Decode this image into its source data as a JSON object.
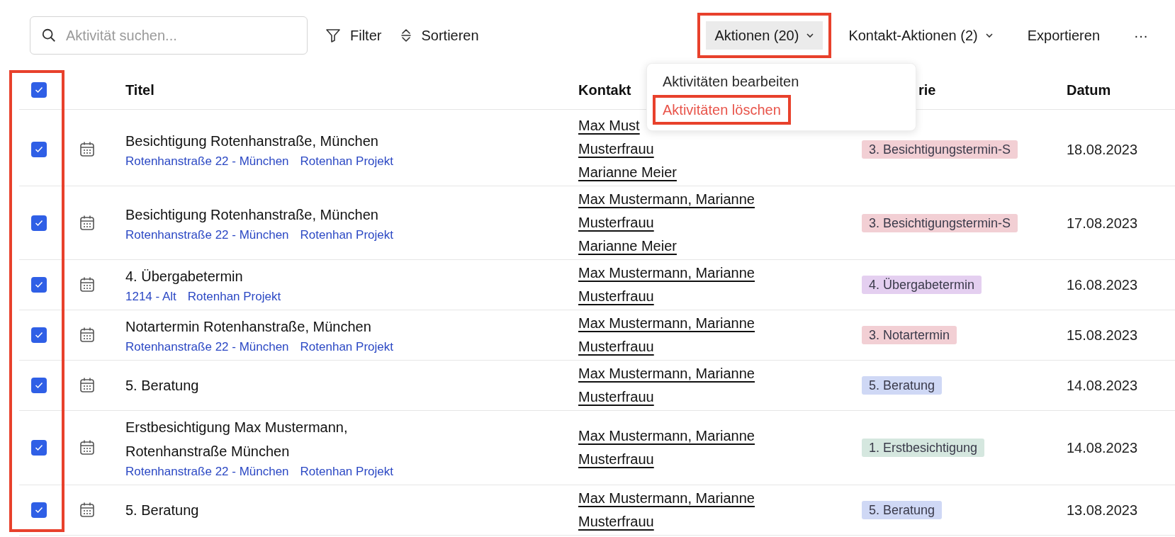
{
  "toolbar": {
    "search": {
      "placeholder": "Aktivität suchen..."
    },
    "tools": [
      {
        "kind": "filter",
        "label": "Filter"
      },
      {
        "kind": "sort",
        "label": "Sortieren"
      }
    ],
    "actions": [
      {
        "kind": "dropdown",
        "label": "Aktionen (20)",
        "open": true,
        "highlighted": true
      },
      {
        "kind": "dropdown",
        "label": "Kontakt-Aktionen (2)",
        "open": false,
        "highlighted": false
      },
      {
        "kind": "plain",
        "label": "Exportieren",
        "open": false,
        "highlighted": false
      },
      {
        "kind": "plain",
        "label": "···",
        "open": false,
        "highlighted": false
      }
    ]
  },
  "menu": {
    "items": [
      {
        "label": "Aktivitäten bearbeiten",
        "danger": false,
        "highlighted": false
      },
      {
        "label": "Aktivitäten löschen",
        "danger": true,
        "highlighted": true
      }
    ]
  },
  "table": {
    "select_all": {
      "checked": true
    },
    "checkbox_column_highlighted": true,
    "columns": [
      "Titel",
      "Kontakt",
      "rie",
      "Datum"
    ],
    "rows": [
      {
        "checked": true,
        "title": "Besichtigung Rotenhanstraße, München",
        "links": [
          "Rotenhanstraße 22 - München",
          "Rotenhan Projekt"
        ],
        "contacts": [
          "Max Must",
          "Musterfrauu",
          "Marianne Meier"
        ],
        "category": {
          "label": "3. Besichtigungstermin-S",
          "color": "#f2cfd4"
        },
        "date": "18.08.2023"
      },
      {
        "checked": true,
        "title": "Besichtigung Rotenhanstraße, München",
        "links": [
          "Rotenhanstraße 22 - München",
          "Rotenhan Projekt"
        ],
        "contacts": [
          "Max Mustermann, Marianne",
          "Musterfrauu",
          "Marianne Meier"
        ],
        "category": {
          "label": "3. Besichtigungstermin-S",
          "color": "#f2cfd4"
        },
        "date": "17.08.2023"
      },
      {
        "checked": true,
        "title": "4. Übergabetermin",
        "links": [
          "1214 - Alt",
          "Rotenhan Projekt"
        ],
        "contacts": [
          "Max Mustermann, Marianne",
          "Musterfrauu"
        ],
        "category": {
          "label": "4. Übergabetermin",
          "color": "#e4cff0"
        },
        "date": "16.08.2023"
      },
      {
        "checked": true,
        "title": "Notartermin Rotenhanstraße, München",
        "links": [
          "Rotenhanstraße 22 - München",
          "Rotenhan Projekt"
        ],
        "contacts": [
          "Max Mustermann, Marianne",
          "Musterfrauu"
        ],
        "category": {
          "label": "3. Notartermin",
          "color": "#f2cfd4"
        },
        "date": "15.08.2023"
      },
      {
        "checked": true,
        "title": "5. Beratung",
        "links": [],
        "contacts": [
          "Max Mustermann, Marianne",
          "Musterfrauu"
        ],
        "category": {
          "label": "5. Beratung",
          "color": "#cfd8f5"
        },
        "date": "14.08.2023"
      },
      {
        "checked": true,
        "title": "Erstbesichtigung Max Mustermann, Rotenhanstraße München",
        "links": [
          "Rotenhanstraße 22 - München",
          "Rotenhan Projekt"
        ],
        "contacts": [
          "Max Mustermann, Marianne",
          "Musterfrauu"
        ],
        "category": {
          "label": "1. Erstbesichtigung",
          "color": "#d5e7df"
        },
        "date": "14.08.2023"
      },
      {
        "checked": true,
        "title": "5. Beratung",
        "links": [],
        "contacts": [
          "Max Mustermann, Marianne",
          "Musterfrauu"
        ],
        "category": {
          "label": "5. Beratung",
          "color": "#cfd8f5"
        },
        "date": "13.08.2023"
      }
    ]
  }
}
